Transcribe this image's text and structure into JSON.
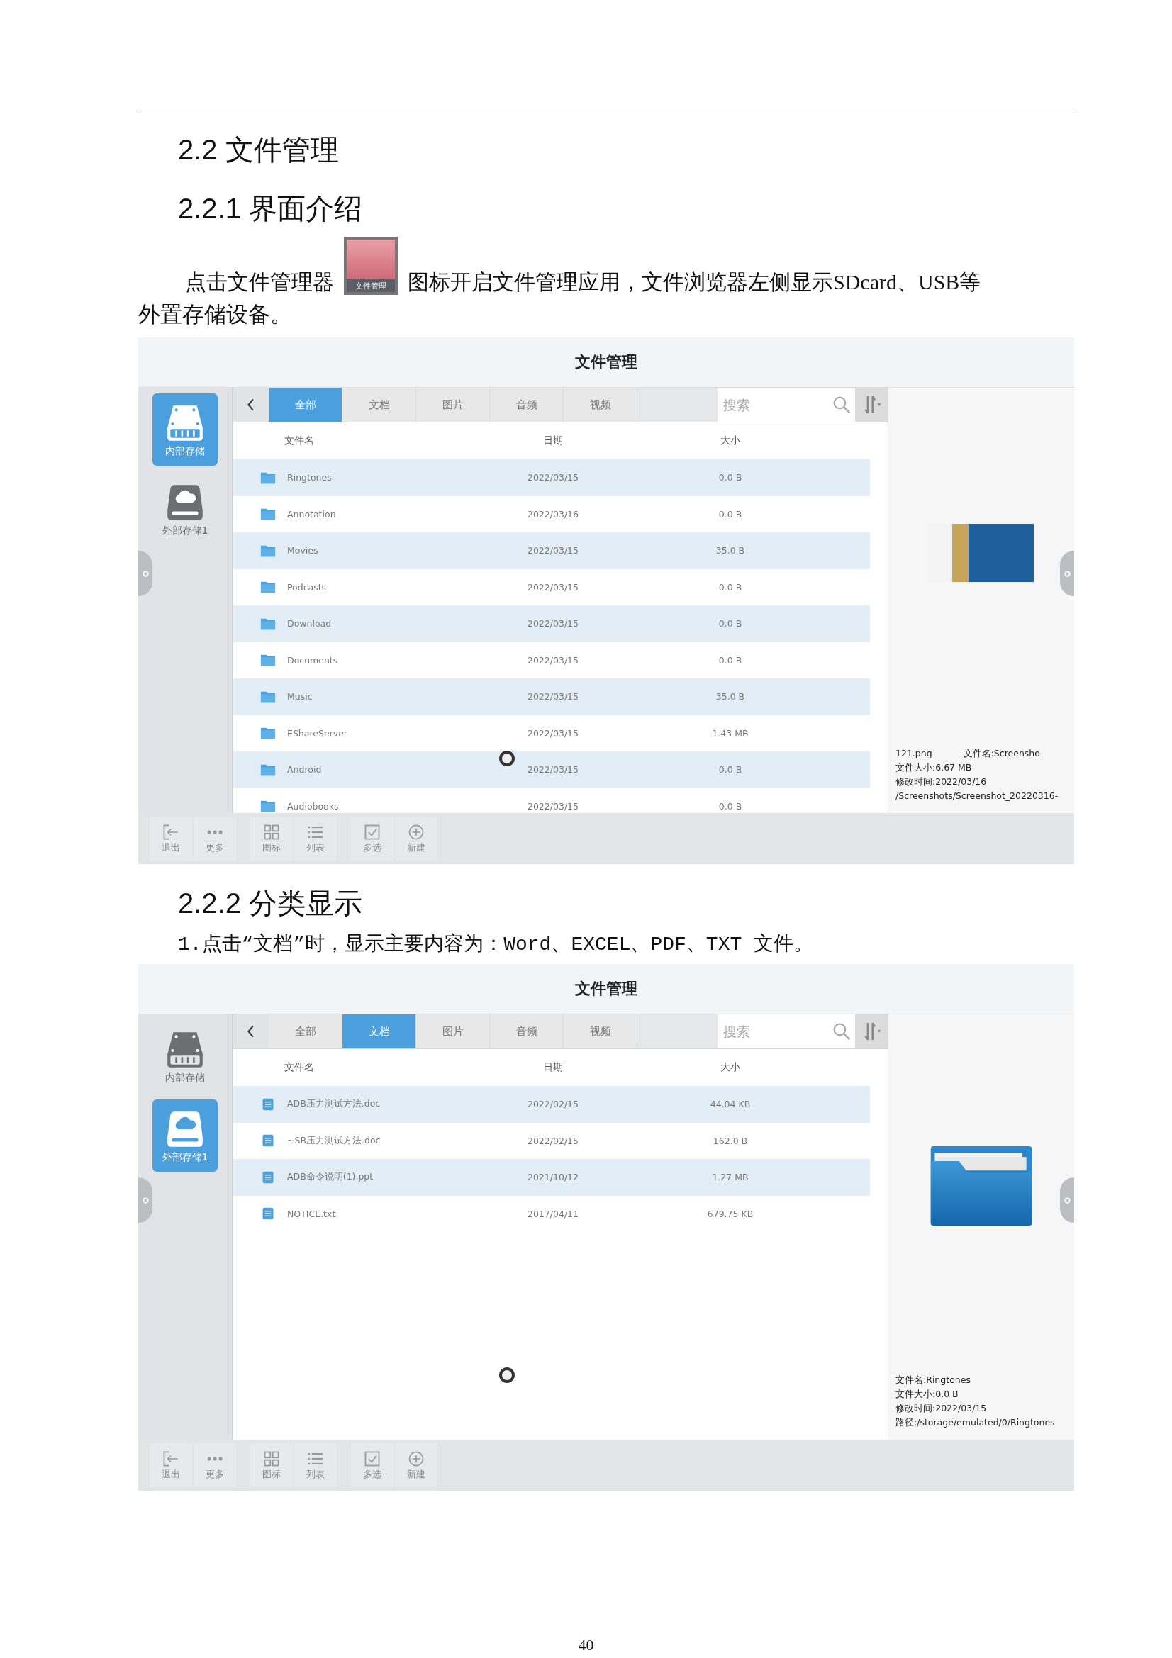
{
  "page": {
    "heading_1": "2.2 文件管理",
    "heading_2": "2.2.1 界面介绍",
    "intro_before_icon": "点击文件管理器",
    "app_icon_label": "文件管理",
    "intro_after_icon": "图标开启文件管理应用，文件浏览器左侧显示SDcard、USB等",
    "intro_continued": "外置存储设备。",
    "heading_3": "2.2.2  分类显示",
    "note": "1.点击“文档”时，显示主要内容为：Word、EXCEL、PDF、TXT 文件。",
    "page_number": "40"
  },
  "screens": [
    {
      "title": "文件管理",
      "storages": [
        {
          "label": "内部存储",
          "kind": "internal",
          "selected": true
        },
        {
          "label": "外部存储1",
          "kind": "external",
          "selected": false
        }
      ],
      "tabs": [
        {
          "label": "全部",
          "selected": true
        },
        {
          "label": "文档",
          "selected": false
        },
        {
          "label": "图片",
          "selected": false
        },
        {
          "label": "音频",
          "selected": false
        },
        {
          "label": "视频",
          "selected": false
        }
      ],
      "search": {
        "placeholder": "搜索"
      },
      "columns": [
        "文件名",
        "日期",
        "大小"
      ],
      "rows": [
        {
          "kind": "folder",
          "name": "Ringtones",
          "date": "2022/03/15",
          "size": "0.0 B"
        },
        {
          "kind": "folder",
          "name": "Annotation",
          "date": "2022/03/16",
          "size": "0.0 B"
        },
        {
          "kind": "folder",
          "name": "Movies",
          "date": "2022/03/15",
          "size": "35.0 B"
        },
        {
          "kind": "folder",
          "name": "Podcasts",
          "date": "2022/03/15",
          "size": "0.0 B"
        },
        {
          "kind": "folder",
          "name": "Download",
          "date": "2022/03/15",
          "size": "0.0 B"
        },
        {
          "kind": "folder",
          "name": "Documents",
          "date": "2022/03/15",
          "size": "0.0 B"
        },
        {
          "kind": "folder",
          "name": "Music",
          "date": "2022/03/15",
          "size": "35.0 B"
        },
        {
          "kind": "folder",
          "name": "EShareServer",
          "date": "2022/03/15",
          "size": "1.43 MB"
        },
        {
          "kind": "folder",
          "name": "Android",
          "date": "2022/03/15",
          "size": "0.0 B"
        },
        {
          "kind": "folder",
          "name": "Audiobooks",
          "date": "2022/03/15",
          "size": "0.0 B"
        }
      ],
      "preview": {
        "kind": "image",
        "lines": [
          [
            "121.png",
            "文件名:Screensho"
          ],
          [
            "文件大小:6.67 MB"
          ],
          [
            "修改时间:2022/03/16"
          ],
          [
            "/Screenshots/Screenshot_20220316-"
          ]
        ]
      },
      "toolbar": [
        {
          "kind": "exit",
          "label": "退出"
        },
        {
          "kind": "more",
          "label": "更多"
        },
        {
          "kind": "grid",
          "label": "图标"
        },
        {
          "kind": "list",
          "label": "列表"
        },
        {
          "kind": "multi",
          "label": "多选"
        },
        {
          "kind": "new",
          "label": "新建"
        }
      ]
    },
    {
      "title": "文件管理",
      "storages": [
        {
          "label": "内部存储",
          "kind": "internal",
          "selected": false
        },
        {
          "label": "外部存储1",
          "kind": "external",
          "selected": true
        }
      ],
      "tabs": [
        {
          "label": "全部",
          "selected": false
        },
        {
          "label": "文档",
          "selected": true
        },
        {
          "label": "图片",
          "selected": false
        },
        {
          "label": "音频",
          "selected": false
        },
        {
          "label": "视频",
          "selected": false
        }
      ],
      "search": {
        "placeholder": "搜索"
      },
      "columns": [
        "文件名",
        "日期",
        "大小"
      ],
      "rows": [
        {
          "kind": "document",
          "name": "ADB压力测试方法.doc",
          "date": "2022/02/15",
          "size": "44.04 KB"
        },
        {
          "kind": "document",
          "name": "~SB压力测试方法.doc",
          "date": "2022/02/15",
          "size": "162.0 B"
        },
        {
          "kind": "document",
          "name": "ADB命令说明(1).ppt",
          "date": "2021/10/12",
          "size": "1.27 MB"
        },
        {
          "kind": "document",
          "name": "NOTICE.txt",
          "date": "2017/04/11",
          "size": "679.75 KB"
        }
      ],
      "preview": {
        "kind": "folder",
        "lines": [
          [
            "文件名:Ringtones"
          ],
          [
            "文件大小:0.0 B"
          ],
          [
            "修改时间:2022/03/15"
          ],
          [
            "路径:/storage/emulated/0/Ringtones"
          ]
        ]
      },
      "toolbar": [
        {
          "kind": "exit",
          "label": "退出"
        },
        {
          "kind": "more",
          "label": "更多"
        },
        {
          "kind": "grid",
          "label": "图标"
        },
        {
          "kind": "list",
          "label": "列表"
        },
        {
          "kind": "multi",
          "label": "多选"
        },
        {
          "kind": "new",
          "label": "新建"
        }
      ]
    }
  ]
}
